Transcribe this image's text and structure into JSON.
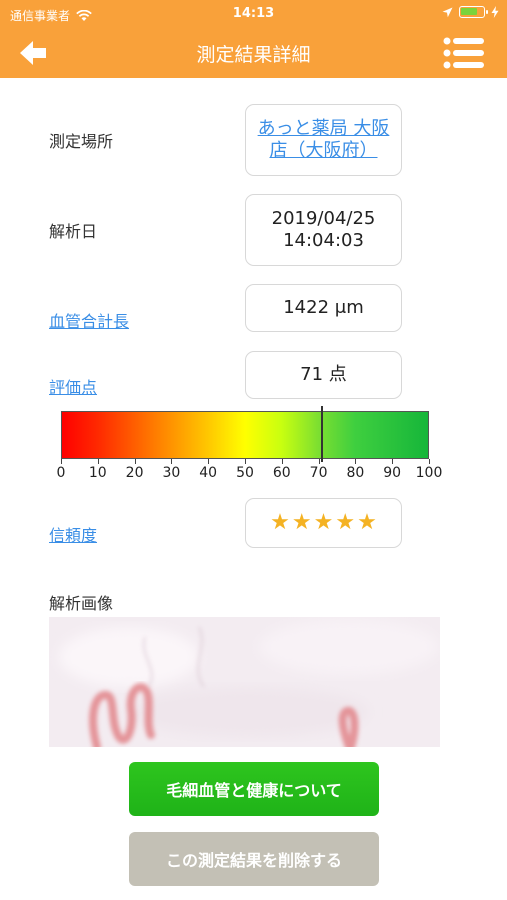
{
  "status_bar": {
    "carrier": "通信事業者",
    "time": "14:13"
  },
  "nav": {
    "title": "測定結果詳細",
    "back_icon": "back-arrow-icon",
    "menu_icon": "list-menu-icon"
  },
  "fields": {
    "location": {
      "label": "測定場所",
      "value": "あっと薬局 大阪店（大阪府）"
    },
    "date": {
      "label": "解析日",
      "value_line1": "2019/04/25",
      "value_line2": "14:04:03"
    },
    "length": {
      "label": "血管合計長",
      "value": "1422 μm"
    },
    "score": {
      "label": "評価点",
      "value": "71 点"
    },
    "reliability": {
      "label": "信頼度",
      "stars": 5
    }
  },
  "scale": {
    "value": 71,
    "ticks": [
      "0",
      "10",
      "20",
      "30",
      "40",
      "50",
      "60",
      "70",
      "80",
      "90",
      "100"
    ],
    "colors": {
      "low": "#ff0000",
      "mid": "#ffff00",
      "high": "#16b63a"
    }
  },
  "image_section": {
    "label": "解析画像"
  },
  "buttons": {
    "health_info": "毛細血管と健康について",
    "delete": "この測定結果を削除する"
  },
  "colors": {
    "accent": "#f9a13a",
    "link": "#3a8ee6",
    "green_button": "#1fb318",
    "gray_button": "#c3c0b5",
    "star": "#f4b223"
  }
}
